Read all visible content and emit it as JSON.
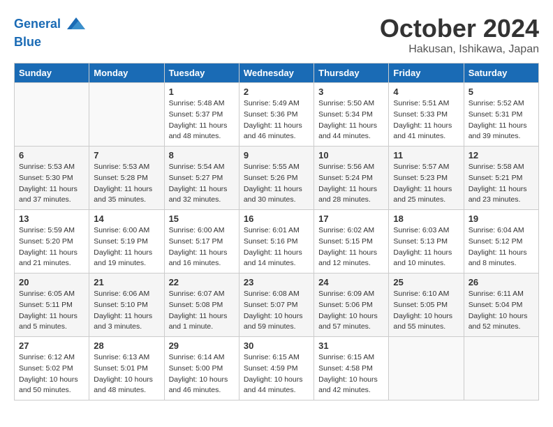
{
  "header": {
    "logo_line1": "General",
    "logo_line2": "Blue",
    "month": "October 2024",
    "location": "Hakusan, Ishikawa, Japan"
  },
  "days_of_week": [
    "Sunday",
    "Monday",
    "Tuesday",
    "Wednesday",
    "Thursday",
    "Friday",
    "Saturday"
  ],
  "weeks": [
    [
      {
        "day": "",
        "info": ""
      },
      {
        "day": "",
        "info": ""
      },
      {
        "day": "1",
        "info": "Sunrise: 5:48 AM\nSunset: 5:37 PM\nDaylight: 11 hours and 48 minutes."
      },
      {
        "day": "2",
        "info": "Sunrise: 5:49 AM\nSunset: 5:36 PM\nDaylight: 11 hours and 46 minutes."
      },
      {
        "day": "3",
        "info": "Sunrise: 5:50 AM\nSunset: 5:34 PM\nDaylight: 11 hours and 44 minutes."
      },
      {
        "day": "4",
        "info": "Sunrise: 5:51 AM\nSunset: 5:33 PM\nDaylight: 11 hours and 41 minutes."
      },
      {
        "day": "5",
        "info": "Sunrise: 5:52 AM\nSunset: 5:31 PM\nDaylight: 11 hours and 39 minutes."
      }
    ],
    [
      {
        "day": "6",
        "info": "Sunrise: 5:53 AM\nSunset: 5:30 PM\nDaylight: 11 hours and 37 minutes."
      },
      {
        "day": "7",
        "info": "Sunrise: 5:53 AM\nSunset: 5:28 PM\nDaylight: 11 hours and 35 minutes."
      },
      {
        "day": "8",
        "info": "Sunrise: 5:54 AM\nSunset: 5:27 PM\nDaylight: 11 hours and 32 minutes."
      },
      {
        "day": "9",
        "info": "Sunrise: 5:55 AM\nSunset: 5:26 PM\nDaylight: 11 hours and 30 minutes."
      },
      {
        "day": "10",
        "info": "Sunrise: 5:56 AM\nSunset: 5:24 PM\nDaylight: 11 hours and 28 minutes."
      },
      {
        "day": "11",
        "info": "Sunrise: 5:57 AM\nSunset: 5:23 PM\nDaylight: 11 hours and 25 minutes."
      },
      {
        "day": "12",
        "info": "Sunrise: 5:58 AM\nSunset: 5:21 PM\nDaylight: 11 hours and 23 minutes."
      }
    ],
    [
      {
        "day": "13",
        "info": "Sunrise: 5:59 AM\nSunset: 5:20 PM\nDaylight: 11 hours and 21 minutes."
      },
      {
        "day": "14",
        "info": "Sunrise: 6:00 AM\nSunset: 5:19 PM\nDaylight: 11 hours and 19 minutes."
      },
      {
        "day": "15",
        "info": "Sunrise: 6:00 AM\nSunset: 5:17 PM\nDaylight: 11 hours and 16 minutes."
      },
      {
        "day": "16",
        "info": "Sunrise: 6:01 AM\nSunset: 5:16 PM\nDaylight: 11 hours and 14 minutes."
      },
      {
        "day": "17",
        "info": "Sunrise: 6:02 AM\nSunset: 5:15 PM\nDaylight: 11 hours and 12 minutes."
      },
      {
        "day": "18",
        "info": "Sunrise: 6:03 AM\nSunset: 5:13 PM\nDaylight: 11 hours and 10 minutes."
      },
      {
        "day": "19",
        "info": "Sunrise: 6:04 AM\nSunset: 5:12 PM\nDaylight: 11 hours and 8 minutes."
      }
    ],
    [
      {
        "day": "20",
        "info": "Sunrise: 6:05 AM\nSunset: 5:11 PM\nDaylight: 11 hours and 5 minutes."
      },
      {
        "day": "21",
        "info": "Sunrise: 6:06 AM\nSunset: 5:10 PM\nDaylight: 11 hours and 3 minutes."
      },
      {
        "day": "22",
        "info": "Sunrise: 6:07 AM\nSunset: 5:08 PM\nDaylight: 11 hours and 1 minute."
      },
      {
        "day": "23",
        "info": "Sunrise: 6:08 AM\nSunset: 5:07 PM\nDaylight: 10 hours and 59 minutes."
      },
      {
        "day": "24",
        "info": "Sunrise: 6:09 AM\nSunset: 5:06 PM\nDaylight: 10 hours and 57 minutes."
      },
      {
        "day": "25",
        "info": "Sunrise: 6:10 AM\nSunset: 5:05 PM\nDaylight: 10 hours and 55 minutes."
      },
      {
        "day": "26",
        "info": "Sunrise: 6:11 AM\nSunset: 5:04 PM\nDaylight: 10 hours and 52 minutes."
      }
    ],
    [
      {
        "day": "27",
        "info": "Sunrise: 6:12 AM\nSunset: 5:02 PM\nDaylight: 10 hours and 50 minutes."
      },
      {
        "day": "28",
        "info": "Sunrise: 6:13 AM\nSunset: 5:01 PM\nDaylight: 10 hours and 48 minutes."
      },
      {
        "day": "29",
        "info": "Sunrise: 6:14 AM\nSunset: 5:00 PM\nDaylight: 10 hours and 46 minutes."
      },
      {
        "day": "30",
        "info": "Sunrise: 6:15 AM\nSunset: 4:59 PM\nDaylight: 10 hours and 44 minutes."
      },
      {
        "day": "31",
        "info": "Sunrise: 6:15 AM\nSunset: 4:58 PM\nDaylight: 10 hours and 42 minutes."
      },
      {
        "day": "",
        "info": ""
      },
      {
        "day": "",
        "info": ""
      }
    ]
  ]
}
